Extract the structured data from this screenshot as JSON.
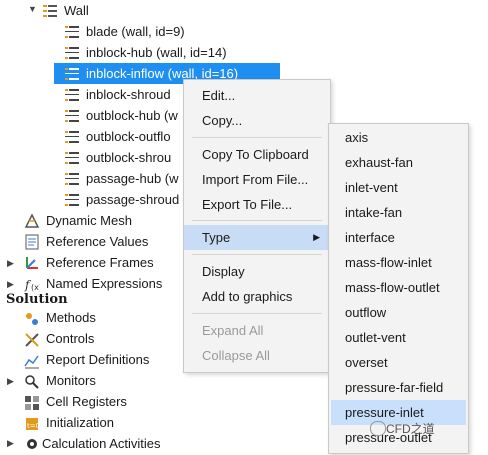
{
  "tree": {
    "wall_group": "Wall",
    "wall_items": [
      "blade (wall, id=9)",
      "inblock-hub (wall, id=14)",
      "inblock-inflow (wall, id=16)",
      "inblock-shroud",
      "outblock-hub (w",
      "outblock-outflo",
      "outblock-shrou",
      "passage-hub (w",
      "passage-shroud"
    ],
    "setup_items": [
      "Dynamic Mesh",
      "Reference Values",
      "Reference Frames",
      "Named Expressions"
    ],
    "solution_header": "Solution",
    "solution_items": [
      "Methods",
      "Controls",
      "Report Definitions",
      "Monitors",
      "Cell Registers",
      "Initialization",
      "Calculation Activities"
    ]
  },
  "context_menu": {
    "items": [
      "Edit...",
      "Copy...",
      "Copy To Clipboard",
      "Import From File...",
      "Export To File...",
      "Type",
      "Display",
      "Add to graphics",
      "Expand All",
      "Collapse All"
    ]
  },
  "type_submenu": {
    "items": [
      "axis",
      "exhaust-fan",
      "inlet-vent",
      "intake-fan",
      "interface",
      "mass-flow-inlet",
      "mass-flow-outlet",
      "outflow",
      "outlet-vent",
      "overset",
      "pressure-far-field",
      "pressure-inlet",
      "pressure-outlet"
    ],
    "selected": "pressure-inlet"
  },
  "watermark": "CFD之道",
  "colors": {
    "selection": "#1e8ff0",
    "menu_highlight": "#c8dcf5"
  }
}
